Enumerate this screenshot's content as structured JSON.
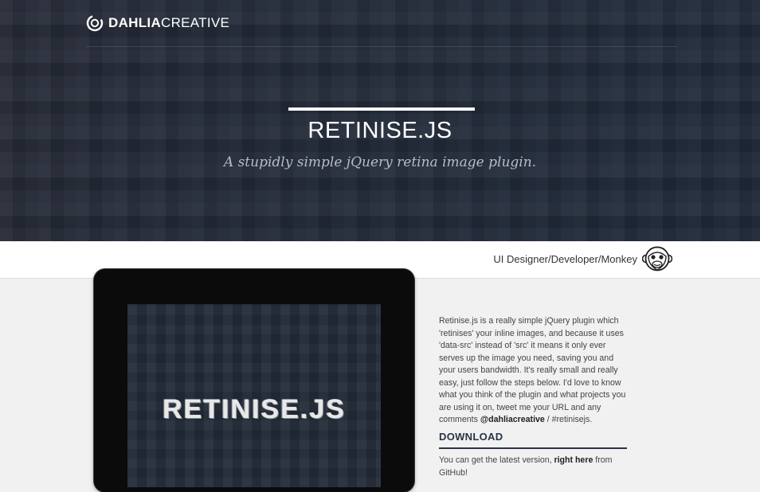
{
  "brand": {
    "name_bold": "DAHLIA",
    "name_regular": "CREATIVE"
  },
  "hero": {
    "title": "RETINISE.JS",
    "subtitle": "A stupidly simple jQuery retina image plugin."
  },
  "subbar": {
    "role": "UI Designer/Developer/Monkey"
  },
  "device": {
    "screen_title": "RETINISE.JS"
  },
  "description": {
    "text": "Retinise.js is a really simple jQuery plugin which 'retinises' your inline images, and because it uses 'data-src' instead of 'src' it means it only ever serves up the image you need, saving you and your users bandwidth. It's really small and really easy, just follow the steps below. I'd love to know what you think of the plugin and what projects you are using it on, tweet me your URL and any comments ",
    "handle": "@dahliacreative",
    "hashtag": " / #retinisejs."
  },
  "download": {
    "title": "DOWNLOAD",
    "text_before": "You can get the latest version, ",
    "link": "right here",
    "text_after": " from GitHub!"
  },
  "colors": {
    "hero_bg": "#232b38",
    "accent": "#2b3446",
    "page_bg": "#f1f1f1"
  },
  "icons": {
    "brand": "dahlia-logo-icon",
    "avatar": "monkey-avatar-icon"
  }
}
